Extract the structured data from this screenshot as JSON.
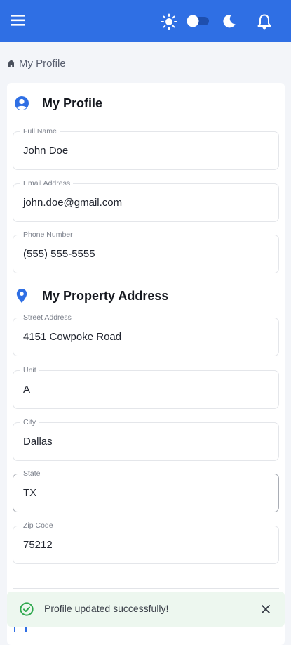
{
  "colors": {
    "primary": "#2f6fe4",
    "toast_bg": "#edf7ef",
    "success": "#2ea84d"
  },
  "topbar": {
    "icons": [
      "menu-icon",
      "sun-icon",
      "theme-toggle",
      "moon-icon",
      "bell-icon"
    ]
  },
  "breadcrumb": {
    "label": "My Profile"
  },
  "profile": {
    "title": "My Profile",
    "fields": {
      "full_name": {
        "label": "Full Name",
        "value": "John Doe"
      },
      "email": {
        "label": "Email Address",
        "value": "john.doe@gmail.com"
      },
      "phone": {
        "label": "Phone Number",
        "value": "(555) 555-5555"
      }
    }
  },
  "address": {
    "title": "My Property Address",
    "fields": {
      "street": {
        "label": "Street Address",
        "value": "4151 Cowpoke Road"
      },
      "unit": {
        "label": "Unit",
        "value": "A"
      },
      "city": {
        "label": "City",
        "value": "Dallas"
      },
      "state": {
        "label": "State",
        "value": "TX"
      },
      "zip": {
        "label": "Zip Code",
        "value": "75212"
      }
    }
  },
  "toast": {
    "message": "Profile updated successfully!"
  }
}
